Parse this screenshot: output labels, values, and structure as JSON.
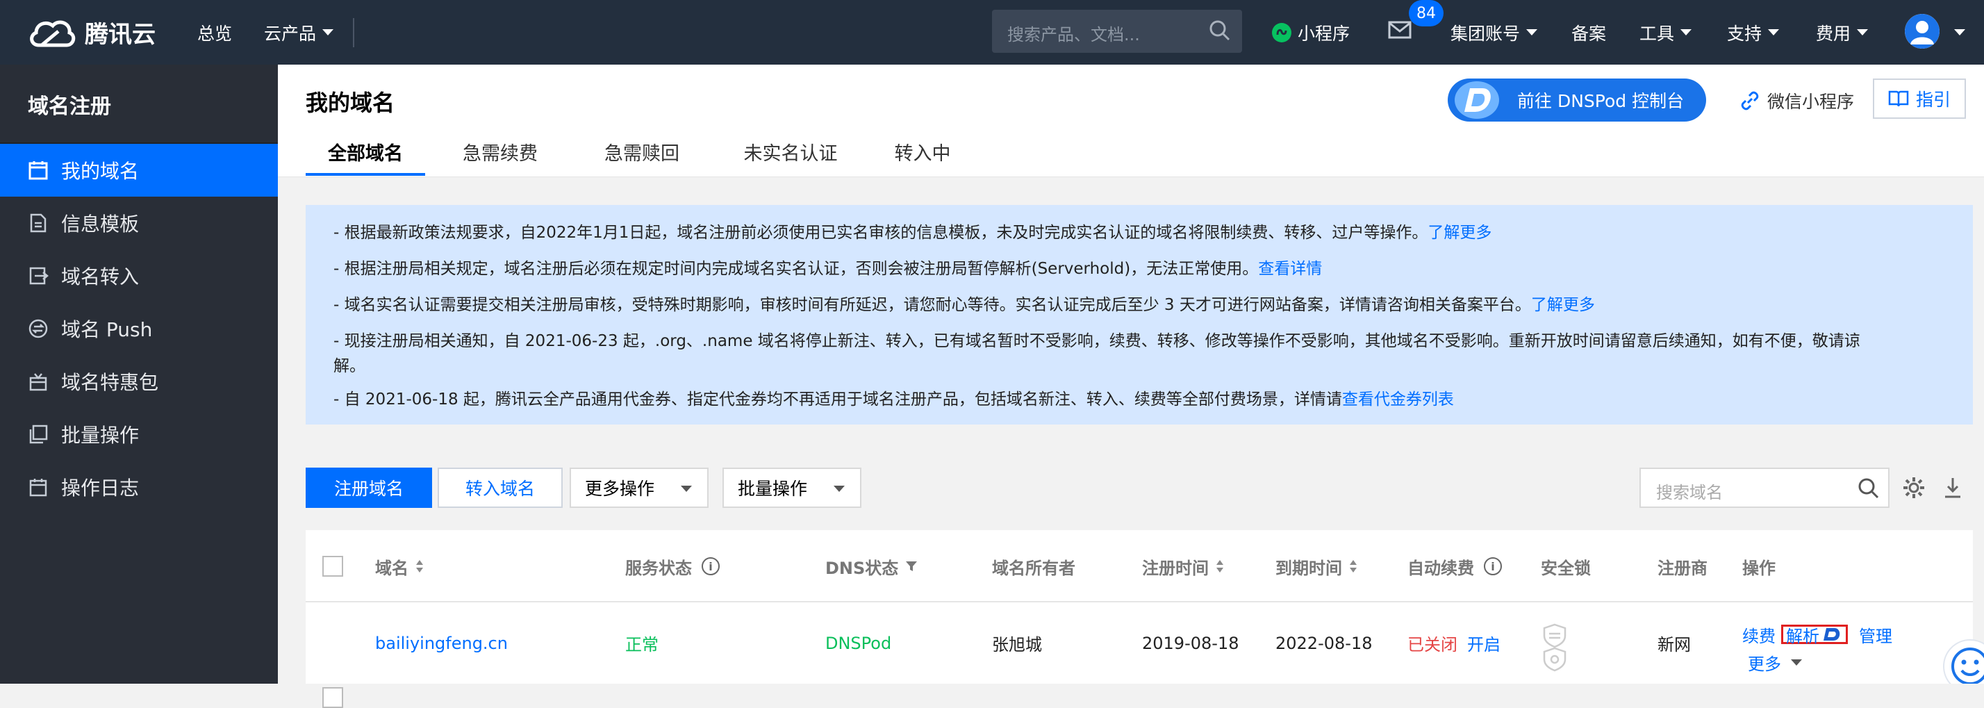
{
  "topbar": {
    "brand": "腾讯云",
    "overview": "总览",
    "products": "云产品",
    "search_placeholder": "搜索产品、文档...",
    "mini_program": "小程序",
    "mail_badge": "84",
    "group_account": "集团账号",
    "filing": "备案",
    "tools": "工具",
    "support": "支持",
    "billing": "费用"
  },
  "sidebar": {
    "title": "域名注册",
    "items": [
      {
        "label": "我的域名",
        "icon": "calendar-icon",
        "active": true
      },
      {
        "label": "信息模板",
        "icon": "document-icon",
        "active": false
      },
      {
        "label": "域名转入",
        "icon": "transfer-in-icon",
        "active": false
      },
      {
        "label": "域名 Push",
        "icon": "push-icon",
        "active": false
      },
      {
        "label": "域名特惠包",
        "icon": "gift-icon",
        "active": false
      },
      {
        "label": "批量操作",
        "icon": "batch-icon",
        "active": false
      },
      {
        "label": "操作日志",
        "icon": "log-icon",
        "active": false
      }
    ]
  },
  "header": {
    "title": "我的域名",
    "dnspod_button": "前往 DNSPod 控制台",
    "wechat_mini": "微信小程序",
    "guide": "指引",
    "tabs": [
      "全部域名",
      "急需续费",
      "急需赎回",
      "未实名认证",
      "转入中"
    ]
  },
  "notice": {
    "lines": [
      {
        "text": "- 根据最新政策法规要求，自2022年1月1日起，域名注册前必须使用已实名审核的信息模板，未及时完成实名认证的域名将限制续费、转移、过户等操作。",
        "link": "了解更多"
      },
      {
        "text": "- 根据注册局相关规定，域名注册后必须在规定时间内完成域名实名认证，否则会被注册局暂停解析(Serverhold)，无法正常使用。",
        "link": "查看详情"
      },
      {
        "text": "- 域名实名认证需要提交相关注册局审核，受特殊时期影响，审核时间有所延迟，请您耐心等待。实名认证完成后至少 3 天才可进行网站备案，详情请咨询相关备案平台。",
        "link": "了解更多"
      },
      {
        "text": "- 现接注册局相关通知，自 2021-06-23 起，.org、.name 域名将停止新注、转入，已有域名暂时不受影响，续费、转移、修改等操作不受影响，其他域名不受影响。重新开放时间请留意后续通知，如有不便，敬请谅",
        "text2": "解。",
        "link": ""
      },
      {
        "text": "- 自 2021-06-18 起，腾讯云全产品通用代金券、指定代金券均不再适用于域名注册产品，包括域名新注、转入、续费等全部付费场景，详情请",
        "link": "查看代金券列表"
      }
    ]
  },
  "toolbar": {
    "register": "注册域名",
    "transfer_in": "转入域名",
    "more_ops": "更多操作",
    "batch_ops": "批量操作",
    "search_placeholder": "搜索域名"
  },
  "table": {
    "headers": {
      "domain": "域名",
      "service_status": "服务状态",
      "dns_status": "DNS状态",
      "owner": "域名所有者",
      "reg_time": "注册时间",
      "expire_time": "到期时间",
      "auto_renew": "自动续费",
      "security_lock": "安全锁",
      "registrar": "注册商",
      "actions": "操作"
    },
    "rows": [
      {
        "domain": "bailiyingfeng.cn",
        "service_status": "正常",
        "dns_status": "DNSPod",
        "owner": "张旭城",
        "reg_time": "2019-08-18",
        "expire_time": "2022-08-18",
        "auto_renew_state": "已关闭",
        "auto_renew_action": "开启",
        "registrar": "新网",
        "action_renew": "续费",
        "action_resolve": "解析",
        "action_manage": "管理",
        "action_more": "更多"
      }
    ]
  },
  "colors": {
    "topbar": "#232f3e",
    "sidebar": "#292e37",
    "accent": "#006eff",
    "notice_bg": "#d5e7ff",
    "success": "#0abf5b",
    "danger": "#e54545"
  }
}
